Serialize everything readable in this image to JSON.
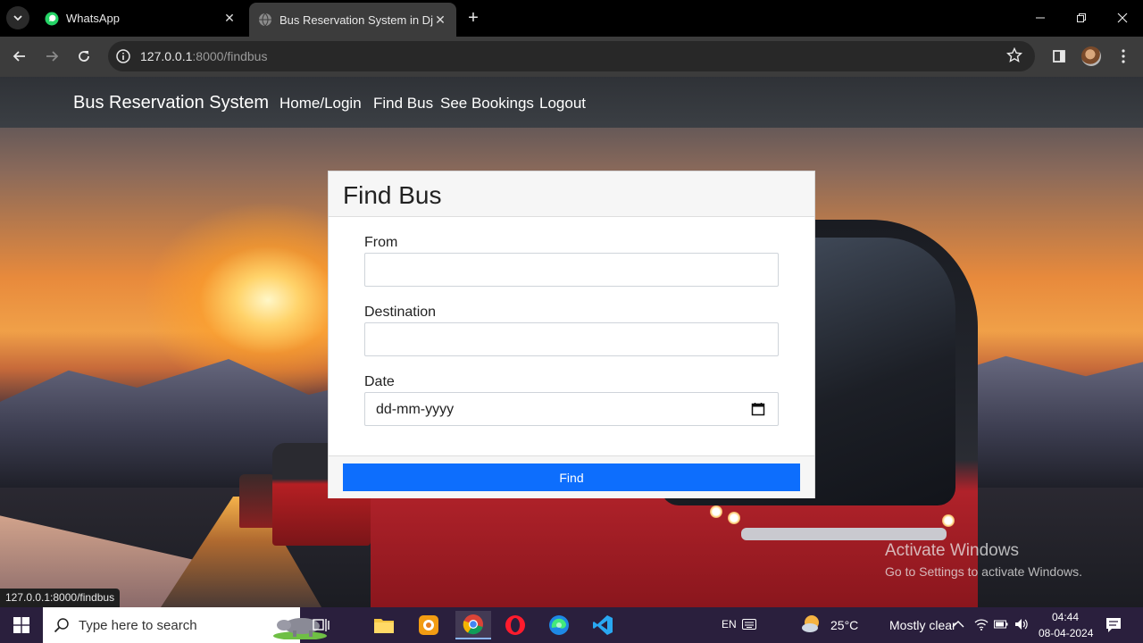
{
  "browser": {
    "tabs": [
      {
        "title": "WhatsApp",
        "icon": "whatsapp-icon",
        "active": false
      },
      {
        "title": "Bus Reservation System in Djang",
        "icon": "globe-icon",
        "active": true
      }
    ],
    "url_host": "127.0.0.1",
    "url_path": ":8000/findbus",
    "status_url": "127.0.0.1:8000/findbus"
  },
  "navbar": {
    "brand": "Bus Reservation System",
    "links": [
      "Home/Login",
      "Find Bus",
      "See Bookings",
      "Logout"
    ]
  },
  "form": {
    "title": "Find Bus",
    "from_label": "From",
    "from_value": "",
    "destination_label": "Destination",
    "destination_value": "",
    "date_label": "Date",
    "date_placeholder": "dd-mm-yyyy",
    "submit_label": "Find"
  },
  "watermark": {
    "line1": "Activate Windows",
    "line2": "Go to Settings to activate Windows."
  },
  "taskbar": {
    "search_placeholder": "Type here to search",
    "language": "EN",
    "weather_temp": "25°C",
    "weather_text": "Mostly clear",
    "time": "04:44",
    "date": "08-04-2024"
  },
  "colors": {
    "primary_button": "#0d6efd",
    "navbar_bg": "#343a40",
    "taskbar_bg": "#2a1f3d"
  }
}
